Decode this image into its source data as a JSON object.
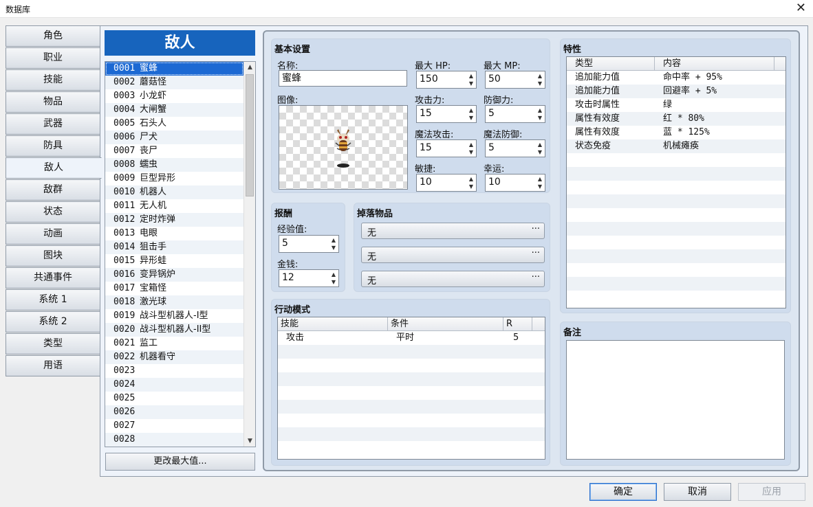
{
  "window": {
    "title": "数据库",
    "close_glyph": "✕"
  },
  "nav": {
    "items": [
      "角色",
      "职业",
      "技能",
      "物品",
      "武器",
      "防具",
      "敌人",
      "敌群",
      "状态",
      "动画",
      "图块",
      "共通事件",
      "系统 1",
      "系统 2",
      "类型",
      "用语"
    ],
    "active": "敌人"
  },
  "list": {
    "header": "敌人",
    "change_max_label": "更改最大值...",
    "items": [
      {
        "id": "0001",
        "name": "蜜蜂"
      },
      {
        "id": "0002",
        "name": "蘑菇怪"
      },
      {
        "id": "0003",
        "name": "小龙虾"
      },
      {
        "id": "0004",
        "name": "大闸蟹"
      },
      {
        "id": "0005",
        "name": "石头人"
      },
      {
        "id": "0006",
        "name": "尸犬"
      },
      {
        "id": "0007",
        "name": "丧尸"
      },
      {
        "id": "0008",
        "name": "蠕虫"
      },
      {
        "id": "0009",
        "name": "巨型异形"
      },
      {
        "id": "0010",
        "name": "机器人"
      },
      {
        "id": "0011",
        "name": "无人机"
      },
      {
        "id": "0012",
        "name": "定时炸弹"
      },
      {
        "id": "0013",
        "name": "电眼"
      },
      {
        "id": "0014",
        "name": "狙击手"
      },
      {
        "id": "0015",
        "name": "异形蛙"
      },
      {
        "id": "0016",
        "name": "变异锅炉"
      },
      {
        "id": "0017",
        "name": "宝箱怪"
      },
      {
        "id": "0018",
        "name": "激光球"
      },
      {
        "id": "0019",
        "name": "战斗型机器人-I型"
      },
      {
        "id": "0020",
        "name": "战斗型机器人-II型"
      },
      {
        "id": "0021",
        "name": "监工"
      },
      {
        "id": "0022",
        "name": "机器看守"
      },
      {
        "id": "0023",
        "name": ""
      },
      {
        "id": "0024",
        "name": ""
      },
      {
        "id": "0025",
        "name": ""
      },
      {
        "id": "0026",
        "name": ""
      },
      {
        "id": "0027",
        "name": ""
      },
      {
        "id": "0028",
        "name": ""
      }
    ]
  },
  "basic": {
    "title": "基本设置",
    "name_label": "名称:",
    "name_value": "蜜蜂",
    "image_label": "图像:",
    "stats": [
      {
        "label": "最大 HP:",
        "value": "150"
      },
      {
        "label": "最大 MP:",
        "value": "50"
      },
      {
        "label": "攻击力:",
        "value": "15"
      },
      {
        "label": "防御力:",
        "value": "5"
      },
      {
        "label": "魔法攻击:",
        "value": "15"
      },
      {
        "label": "魔法防御:",
        "value": "5"
      },
      {
        "label": "敏捷:",
        "value": "10"
      },
      {
        "label": "幸运:",
        "value": "10"
      }
    ]
  },
  "reward": {
    "title": "报酬",
    "exp_label": "经验值:",
    "exp_value": "5",
    "gold_label": "金钱:",
    "gold_value": "12"
  },
  "drops": {
    "title": "掉落物品",
    "items": [
      "无",
      "无",
      "无"
    ],
    "dots": "···"
  },
  "actions": {
    "title": "行动模式",
    "columns": [
      "技能",
      "条件",
      "R"
    ],
    "rows": [
      {
        "skill": "攻击",
        "condition": "平时",
        "r": "5"
      }
    ]
  },
  "traits": {
    "title": "特性",
    "columns": [
      "类型",
      "内容"
    ],
    "rows": [
      {
        "type": "追加能力值",
        "content": "命中率 + 95%"
      },
      {
        "type": "追加能力值",
        "content": "回避率 + 5%"
      },
      {
        "type": "攻击时属性",
        "content": "绿"
      },
      {
        "type": "属性有效度",
        "content": "红 * 80%"
      },
      {
        "type": "属性有效度",
        "content": "蓝 * 125%"
      },
      {
        "type": "状态免疫",
        "content": "机械瘫痪"
      }
    ]
  },
  "notes": {
    "title": "备注",
    "text": ""
  },
  "buttons": {
    "ok": "确定",
    "cancel": "取消",
    "apply": "应用"
  }
}
